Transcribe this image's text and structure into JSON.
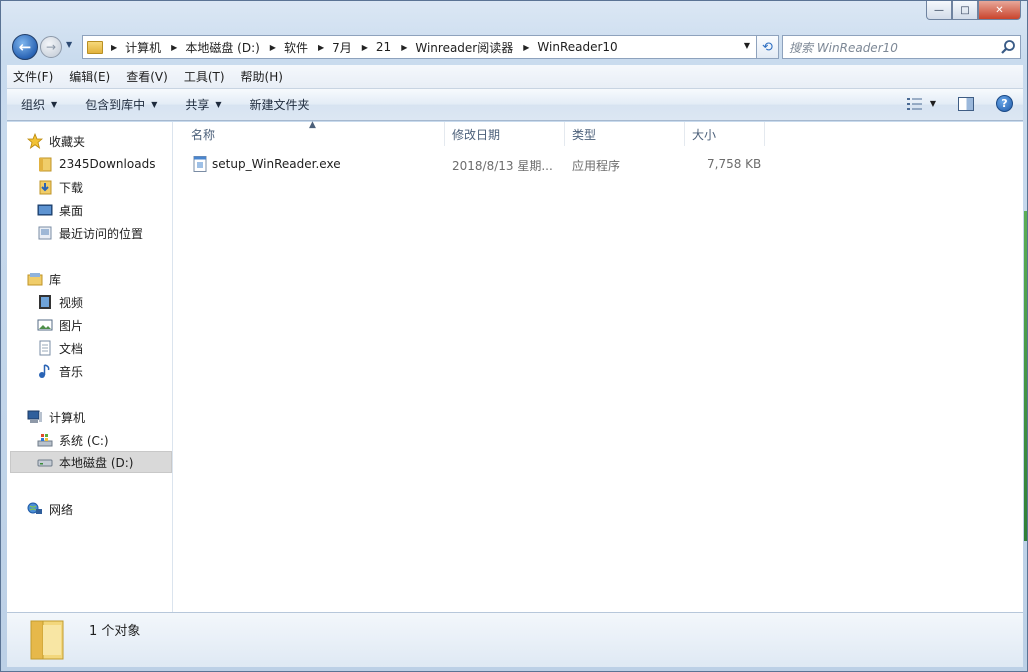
{
  "window": {
    "caption": {
      "minimize": "—",
      "maximize": "□",
      "close": "✕"
    }
  },
  "address": {
    "crumbs": [
      "计算机",
      "本地磁盘 (D:)",
      "软件",
      "7月",
      "21",
      "Winreader阅读器",
      "WinReader10"
    ]
  },
  "search": {
    "placeholder": "搜索 WinReader10"
  },
  "menu": [
    "文件(F)",
    "编辑(E)",
    "查看(V)",
    "工具(T)",
    "帮助(H)"
  ],
  "toolbar": {
    "organize": "组织",
    "include_library": "包含到库中",
    "share": "共享",
    "new_folder": "新建文件夹",
    "help": "?"
  },
  "sidebar": {
    "favorites": {
      "label": "收藏夹",
      "items": [
        "2345Downloads",
        "下载",
        "桌面",
        "最近访问的位置"
      ]
    },
    "libraries": {
      "label": "库",
      "items": [
        "视频",
        "图片",
        "文档",
        "音乐"
      ]
    },
    "computer": {
      "label": "计算机",
      "items": [
        "系统 (C:)",
        "本地磁盘 (D:)"
      ],
      "selected": "本地磁盘 (D:)"
    },
    "network": {
      "label": "网络"
    }
  },
  "columns": [
    "名称",
    "修改日期",
    "类型",
    "大小"
  ],
  "files": [
    {
      "name": "setup_WinReader.exe",
      "modified": "2018/8/13 星期...",
      "type": "应用程序",
      "size": "7,758 KB"
    }
  ],
  "details": {
    "summary": "1 个对象"
  },
  "colors": {
    "selected_row": "#d9d9d9",
    "header_text": "#4c607a",
    "accent": "#2a64b5"
  }
}
